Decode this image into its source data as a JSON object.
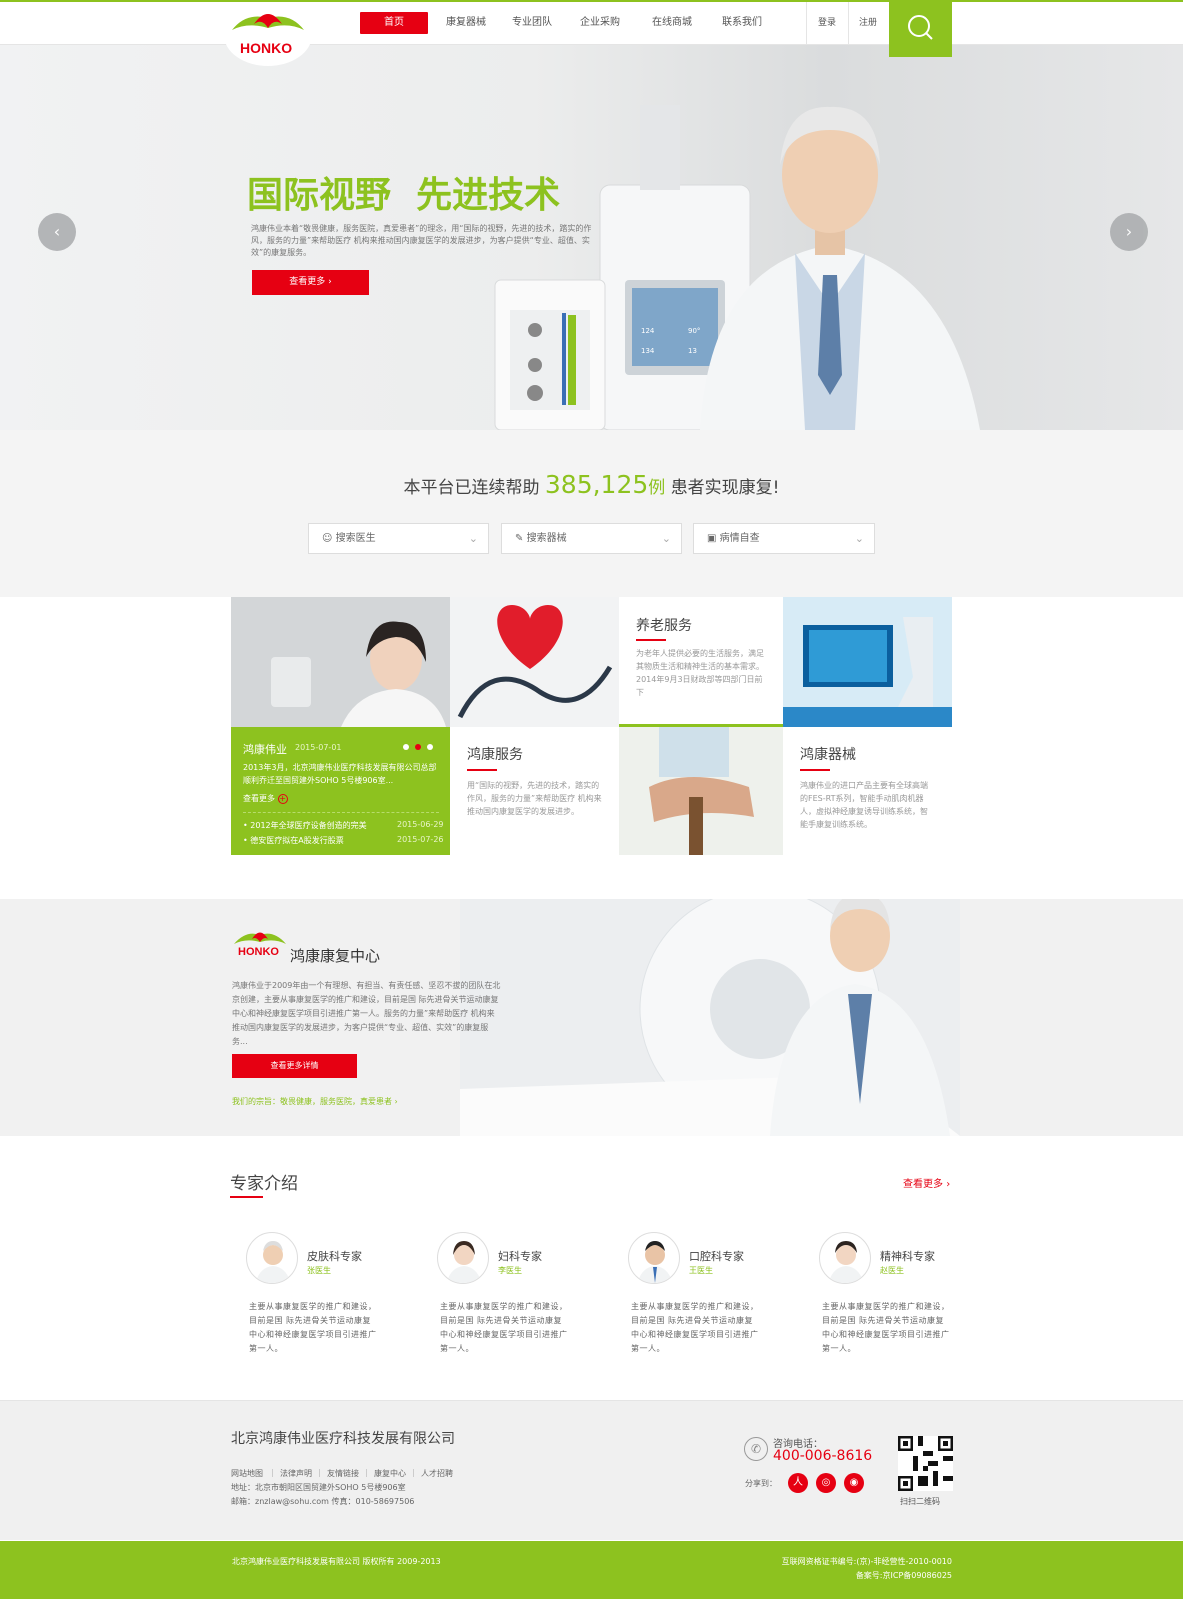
{
  "brand": {
    "logo_text": "HONKO",
    "accent_green": "#8dc21f",
    "accent_red": "#e60012"
  },
  "nav": {
    "items": [
      "首页",
      "康复器械",
      "专业团队",
      "企业采购",
      "在线商城",
      "联系我们"
    ],
    "login": "登录",
    "register": "注册"
  },
  "hero": {
    "title": "国际视野  先进技术",
    "desc": "鸿康伟业本着“敬畏健康，服务医院，真爱患者”的理念，用“国际的视野，先进的技术，踏实的作风，服务的力量”来帮助医疗 机构来推动国内康复医学的发展进步，为客户提供“专业、超值、实效”的康复服务。",
    "more": "查看更多",
    "monitor": [
      "124",
      "90°",
      "134",
      "13"
    ]
  },
  "stats": {
    "prefix": "本平台已连续帮助",
    "count": "385,125",
    "unit": "例",
    "suffix": "患者实现康复!"
  },
  "search": [
    {
      "label": "搜索医生",
      "icon": "doctor-icon"
    },
    {
      "label": "搜索器械",
      "icon": "syringe-icon"
    },
    {
      "label": "病情自查",
      "icon": "medkit-icon"
    }
  ],
  "news": {
    "title": "鸿康伟业",
    "date": "2015-07-01",
    "text": "2013年3月，北京鸿康伟业医疗科技发展有限公司总部顺利乔迁至国贸建外SOHO 5号楼906室...",
    "more": "查看更多",
    "items": [
      {
        "title": "2012年全球医疗设备创造的完美",
        "date": "2015-06-29"
      },
      {
        "title": "德安医疗拟在A股发行股票",
        "date": "2015-07-26"
      }
    ]
  },
  "tiles": {
    "service": {
      "title": "鸿康服务",
      "text": "用“国际的视野，先进的技术，踏实的作风，服务的力量”来帮助医疗 机构来推动国内康复医学的发展进步。"
    },
    "elder": {
      "title": "养老服务",
      "text": "为老年人提供必要的生活服务，满足其物质生活和精神生活的基本需求。2014年9月3日财政部等四部门日前下"
    },
    "device": {
      "title": "鸿康器械",
      "text": "鸿康伟业的进口产品主要有全球高端的FES-RT系列，智能手动肌肉机器人，虚拟神经康复诱导训练系统，智能手康复训练系统。"
    }
  },
  "center": {
    "logo_text": "HONKO",
    "title": "鸿康康复中心",
    "desc": "鸿康伟业于2009年由一个有理想、有担当、有责任感、坚忍不拔的团队在北京创建，主要从事康复医学的推广和建设，目前是国 际先进骨关节运动康复中心和神经康复医学项目引进推广第一人。服务的力量”来帮助医疗 机构来推动国内康复医学的发展进步，为客户提供“专业、超值、实效”的康复服务...",
    "btn": "查看更多详情",
    "tagline": "我们的宗旨：敬畏健康，服务医院，真爱患者"
  },
  "experts": {
    "title": "专家介绍",
    "more": "查看更多",
    "list": [
      {
        "title": "皮肤科专家",
        "name": "张医生",
        "desc": "主要从事康复医学的推广和建设，目前是国 际先进骨关节运动康复中心和神经康复医学项目引进推广第一人。"
      },
      {
        "title": "妇科专家",
        "name": "李医生",
        "desc": "主要从事康复医学的推广和建设，目前是国 际先进骨关节运动康复中心和神经康复医学项目引进推广第一人。"
      },
      {
        "title": "口腔科专家",
        "name": "王医生",
        "desc": "主要从事康复医学的推广和建设，目前是国 际先进骨关节运动康复中心和神经康复医学项目引进推广第一人。"
      },
      {
        "title": "精神科专家",
        "name": "赵医生",
        "desc": "主要从事康复医学的推广和建设，目前是国 际先进骨关节运动康复中心和神经康复医学项目引进推广第一人。"
      }
    ]
  },
  "footer": {
    "company": "北京鸿康伟业医疗科技发展有限公司",
    "links": [
      "网站地图",
      "法律声明",
      "友情链接",
      "康复中心",
      "人才招聘"
    ],
    "address": "地址：北京市朝阳区国贸建外SOHO 5号楼906室",
    "contact": "邮箱：znzlaw@sohu.com  传真：010-58697506",
    "phone_label": "咨询电话：",
    "phone": "400-006-8616",
    "share_label": "分享到：",
    "qr_label": "扫扫二维码",
    "copyright": "北京鸿康伟业医疗科技发展有限公司 版权所有 2009-2013",
    "license": "互联网资格证书编号:(京)-非经营性-2010-0010",
    "icp": "备案号:京ICP备09086025"
  }
}
